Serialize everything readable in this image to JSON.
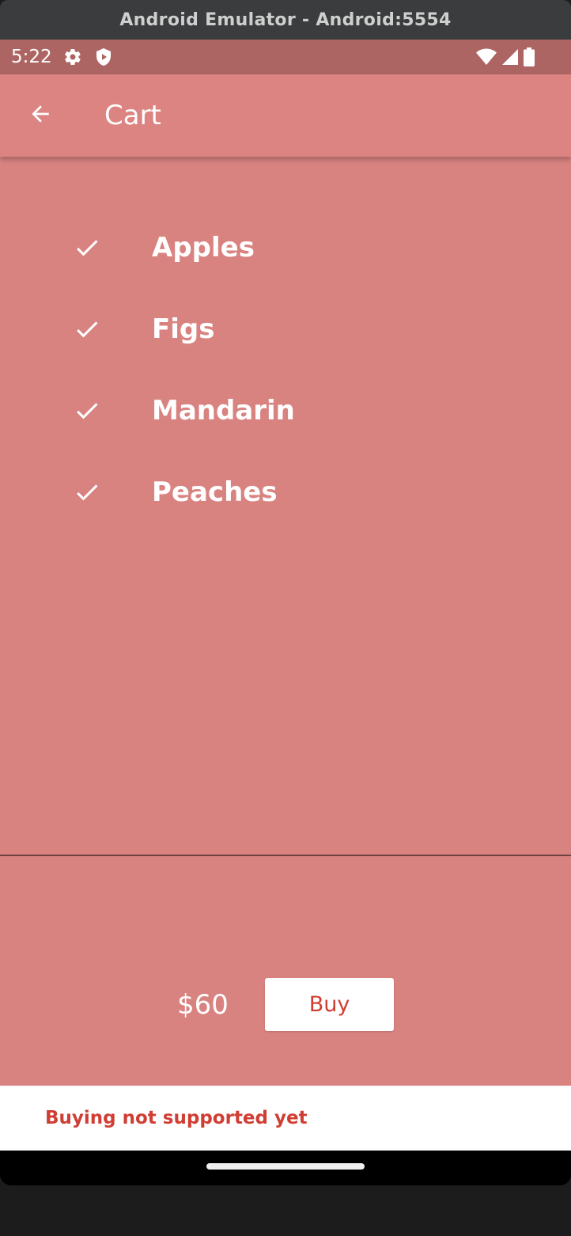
{
  "window": {
    "title": "Android Emulator - Android:5554"
  },
  "status_bar": {
    "time": "5:22",
    "left_icons": [
      "gear-icon",
      "shield-icon"
    ],
    "right_icons": [
      "wifi-icon",
      "cell-signal-icon",
      "battery-icon"
    ]
  },
  "app_bar": {
    "title": "Cart",
    "back_icon": "arrow-left-icon"
  },
  "cart": {
    "items": [
      {
        "name": "Apples",
        "icon": "check-icon"
      },
      {
        "name": "Figs",
        "icon": "check-icon"
      },
      {
        "name": "Mandarin",
        "icon": "check-icon"
      },
      {
        "name": "Peaches",
        "icon": "check-icon"
      }
    ]
  },
  "checkout": {
    "total": "$60",
    "buy_label": "Buy"
  },
  "snackbar": {
    "message": "Buying not supported yet"
  },
  "colors": {
    "primary": "#db8482",
    "status_bar": "#ac6563",
    "accent_text": "#d03d33"
  }
}
